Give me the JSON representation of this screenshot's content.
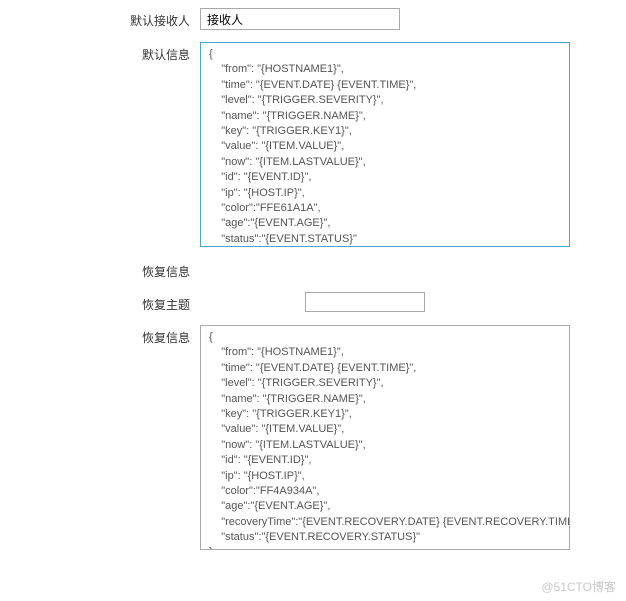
{
  "recipient": {
    "label": "默认接收人",
    "value": "接收人"
  },
  "defaultMessage": {
    "label": "默认信息",
    "content": "{\n    \"from\": \"{HOSTNAME1}\",\n    \"time\": \"{EVENT.DATE} {EVENT.TIME}\",\n    \"level\": \"{TRIGGER.SEVERITY}\",\n    \"name\": \"{TRIGGER.NAME}\",\n    \"key\": \"{TRIGGER.KEY1}\",\n    \"value\": \"{ITEM.VALUE}\",\n    \"now\": \"{ITEM.LASTVALUE}\",\n    \"id\": \"{EVENT.ID}\",\n    \"ip\": \"{HOST.IP}\",\n    \"color\":\"FFE61A1A\",\n    \"age\":\"{EVENT.AGE}\",\n    \"status\":\"{EVENT.STATUS}\"\n}"
  },
  "recoveryInfo": {
    "label": "恢复信息",
    "value": ""
  },
  "recoverySubject": {
    "label": "恢复主题",
    "value": ""
  },
  "recoveryMessage": {
    "label": "恢复信息",
    "content": "{\n    \"from\": \"{HOSTNAME1}\",\n    \"time\": \"{EVENT.DATE} {EVENT.TIME}\",\n    \"level\": \"{TRIGGER.SEVERITY}\",\n    \"name\": \"{TRIGGER.NAME}\",\n    \"key\": \"{TRIGGER.KEY1}\",\n    \"value\": \"{ITEM.VALUE}\",\n    \"now\": \"{ITEM.LASTVALUE}\",\n    \"id\": \"{EVENT.ID}\",\n    \"ip\": \"{HOST.IP}\",\n    \"color\":\"FF4A934A\",\n    \"age\":\"{EVENT.AGE}\",\n    \"recoveryTime\":\"{EVENT.RECOVERY.DATE} {EVENT.RECOVERY.TIME}\",\n    \"status\":\"{EVENT.RECOVERY.STATUS}\"\n}"
  },
  "watermark": "@51CTO博客"
}
